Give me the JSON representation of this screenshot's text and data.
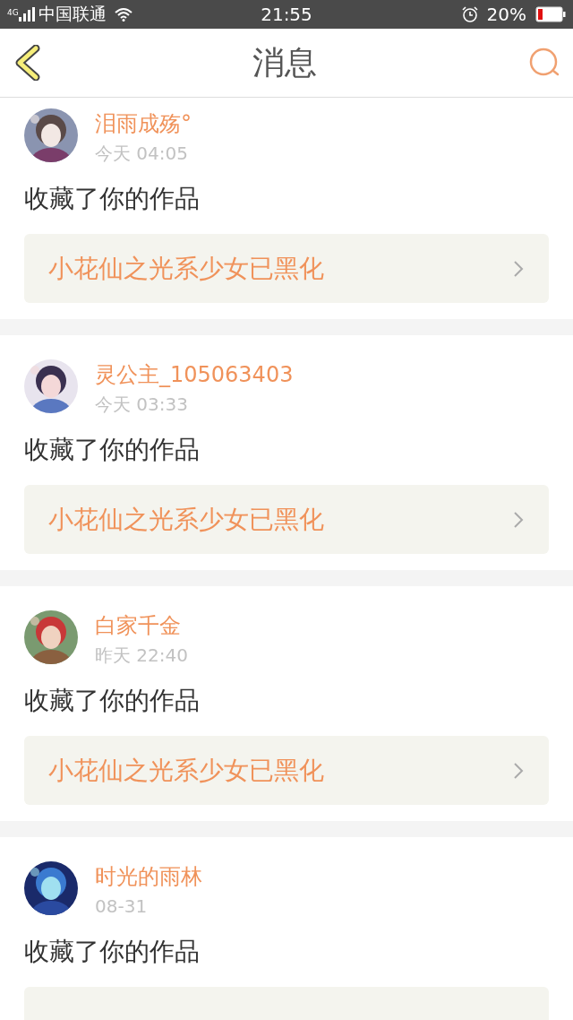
{
  "status_bar": {
    "network": "4G",
    "carrier": "中国联通",
    "time": "21:55",
    "battery": "20%"
  },
  "header": {
    "title": "消息"
  },
  "messages": [
    {
      "user": "泪雨成殇°",
      "time": "今天 04:05",
      "action": "收藏了你的作品",
      "work": "小花仙之光系少女已黑化"
    },
    {
      "user": "灵公主_105063403",
      "time": "今天 03:33",
      "action": "收藏了你的作品",
      "work": "小花仙之光系少女已黑化"
    },
    {
      "user": "白家千金",
      "time": "昨天 22:40",
      "action": "收藏了你的作品",
      "work": "小花仙之光系少女已黑化"
    },
    {
      "user": "时光的雨林",
      "time": "08-31",
      "action": "收藏了你的作品"
    }
  ]
}
